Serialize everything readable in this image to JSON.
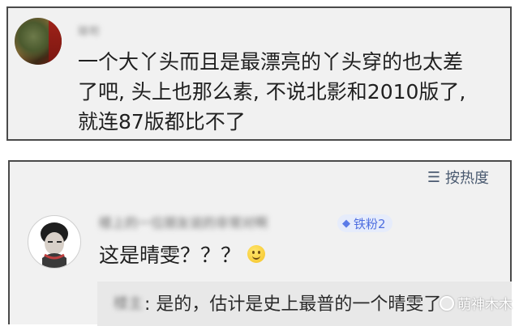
{
  "comment1": {
    "user_blurred": "琼珩",
    "lines": [
      "一个大丫头而且是最漂亮的丫头穿的也太差",
      "了吧, 头上也那么素, 不说北影和2010版了,",
      "就连87版都比不了"
    ]
  },
  "comment2": {
    "sort_label": "按热度",
    "sort_icon": "sort-lines-icon",
    "user_blurred": "楼上的一位朋友说的非常对啊",
    "badge_label": "铁粉2",
    "badge_icon": "diamond-icon",
    "text": "这是晴雯？？？",
    "emoji": "smile-emoji",
    "reply": {
      "user_blurred": "楼主",
      "text": ": 是的，估计是史上最普的一个晴雯了"
    }
  },
  "watermark": {
    "text": "萌神木木"
  },
  "colors": {
    "card_bg": "#f1f1f1",
    "card_border": "#4a4a4a",
    "badge_bg": "#e6ecfb",
    "badge_text": "#4f6fe0"
  }
}
